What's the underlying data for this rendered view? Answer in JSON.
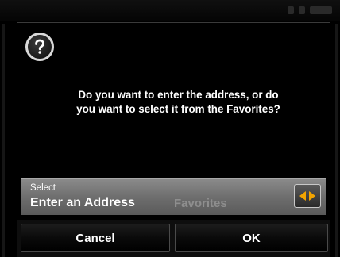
{
  "dialog": {
    "message_line1": "Do you want to enter the address, or do",
    "message_line2": "you want to select it from the Favorites?",
    "help_icon": "question-mark-icon"
  },
  "selector": {
    "caption": "Select",
    "selected_option": "Enter an Address",
    "other_option": "Favorites",
    "arrow_icon": "left-right-arrows-icon",
    "arrow_color": "#f2a400"
  },
  "buttons": {
    "cancel_label": "Cancel",
    "ok_label": "OK"
  }
}
